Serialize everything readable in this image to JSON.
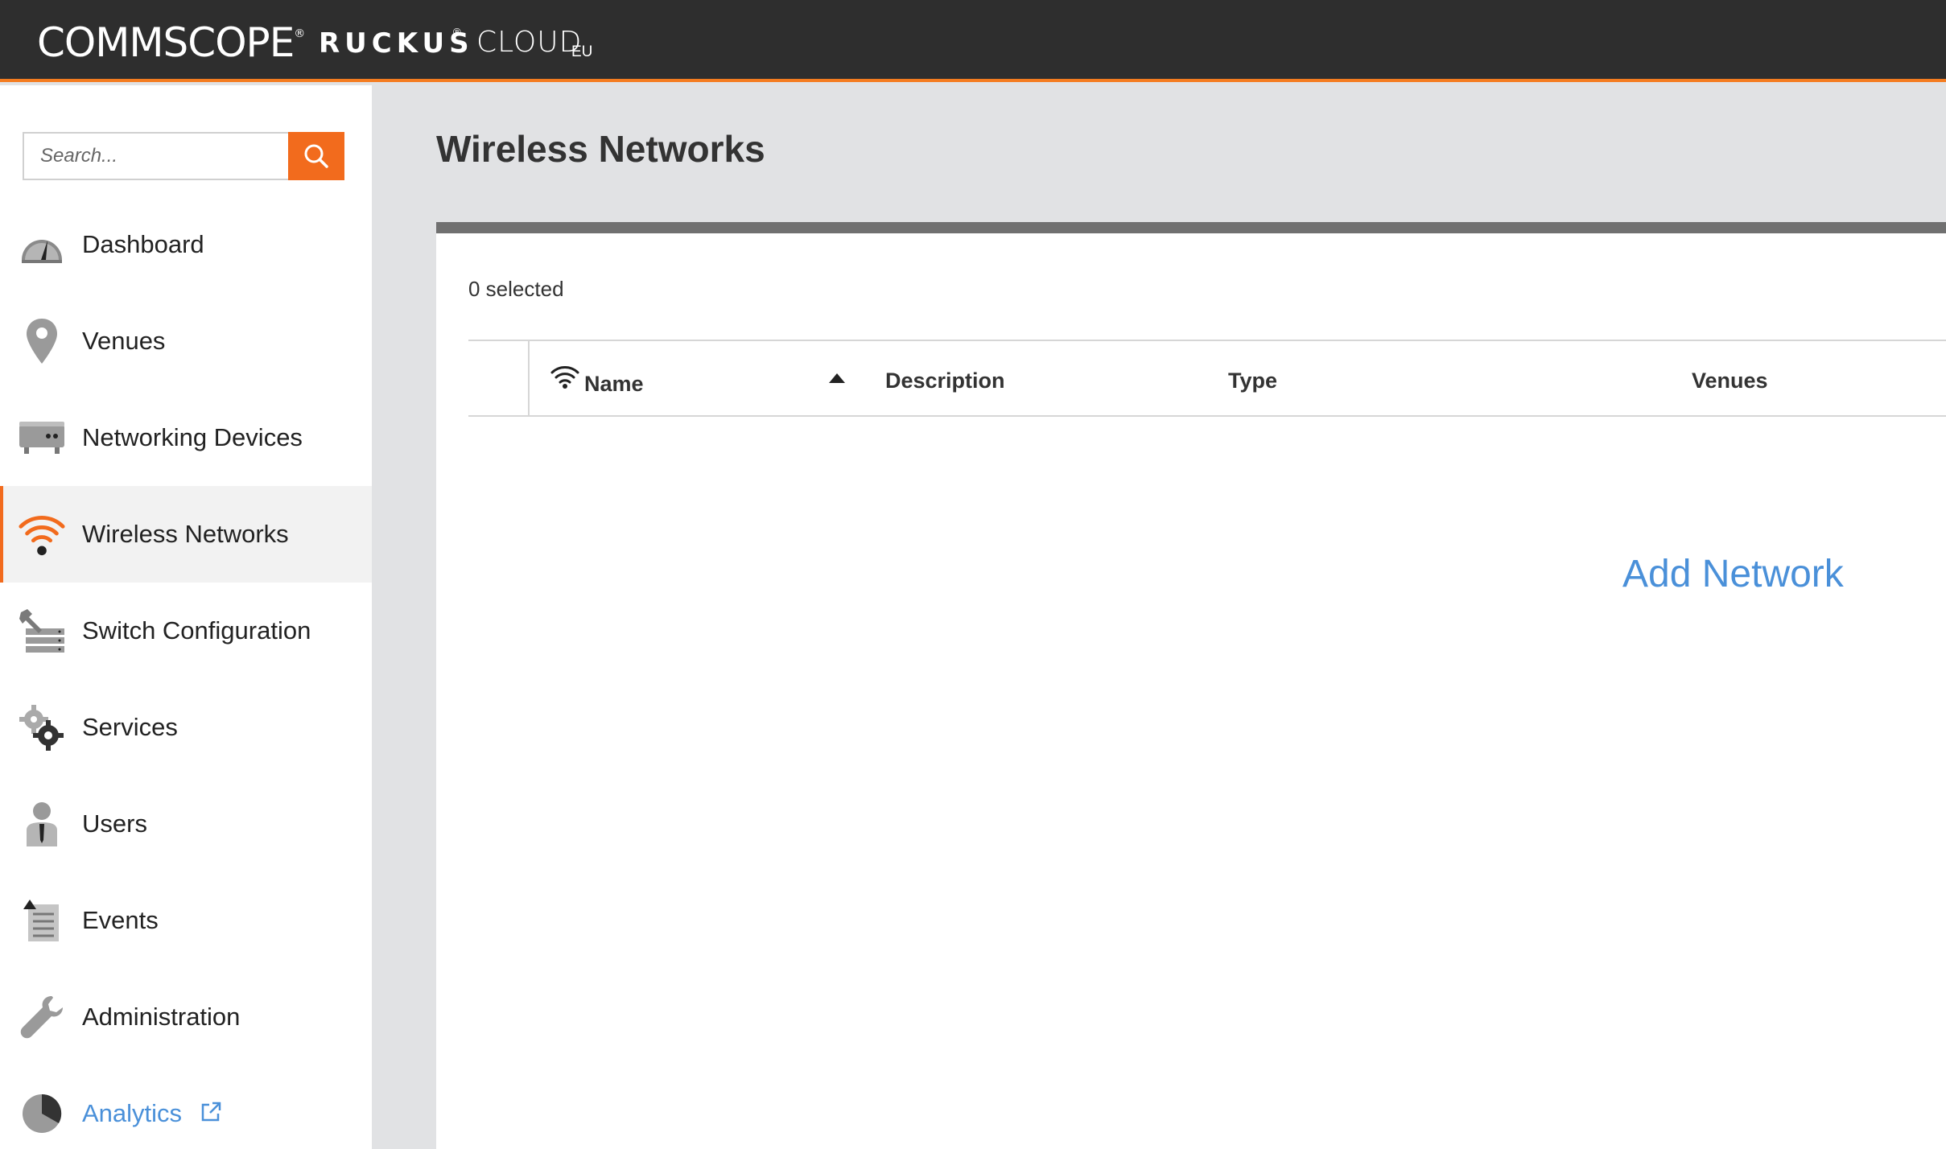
{
  "header": {
    "brand_commscope": "COMMSCOPE",
    "brand_commscope_reg": "®",
    "brand_ruckus": "RUCKUS",
    "brand_ruckus_reg": "®",
    "brand_cloud": "CLOUD",
    "brand_region": "EU",
    "accent_color": "#f47c20"
  },
  "sidebar": {
    "search_placeholder": "Search...",
    "items": [
      {
        "label": "Dashboard",
        "icon": "dashboard-gauge-icon"
      },
      {
        "label": "Venues",
        "icon": "map-pin-icon"
      },
      {
        "label": "Networking Devices",
        "icon": "router-device-icon"
      },
      {
        "label": "Wireless Networks",
        "icon": "wifi-icon",
        "active": true
      },
      {
        "label": "Switch Configuration",
        "icon": "switch-config-icon"
      },
      {
        "label": "Services",
        "icon": "gears-icon"
      },
      {
        "label": "Users",
        "icon": "user-icon"
      },
      {
        "label": "Events",
        "icon": "events-list-icon"
      },
      {
        "label": "Administration",
        "icon": "wrench-icon"
      },
      {
        "label": "Analytics",
        "icon": "pie-chart-icon",
        "external": true
      }
    ]
  },
  "main": {
    "title": "Wireless Networks",
    "selected_text": "0 selected",
    "columns": [
      "Name",
      "Description",
      "Type",
      "Venues"
    ],
    "sort_column": "Name",
    "sort_direction": "ascending",
    "empty_action": "Add Network",
    "link_color": "#4a90d9"
  }
}
